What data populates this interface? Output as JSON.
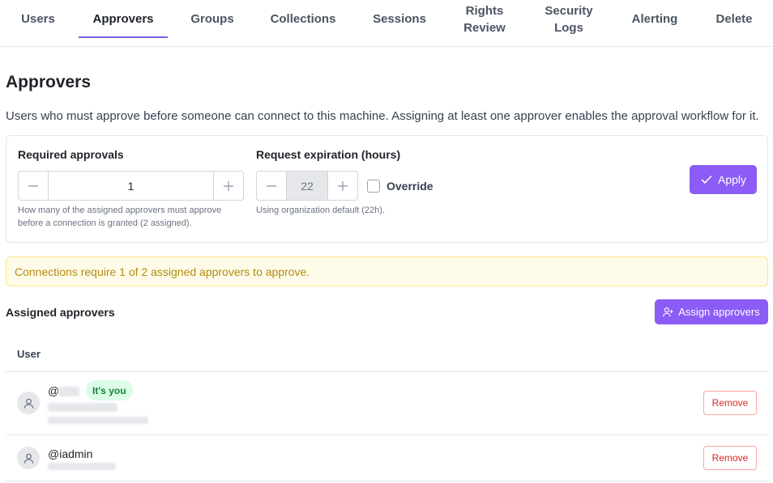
{
  "tabs": [
    {
      "label": "Users"
    },
    {
      "label": "Approvers",
      "active": true
    },
    {
      "label": "Groups"
    },
    {
      "label": "Collections"
    },
    {
      "label": "Sessions"
    },
    {
      "label": "Rights Review"
    },
    {
      "label": "Security Logs"
    },
    {
      "label": "Alerting"
    },
    {
      "label": "Delete"
    }
  ],
  "page": {
    "title": "Approvers",
    "description": "Users who must approve before someone can connect to this machine. Assigning at least one approver enables the approval workflow for it."
  },
  "settings": {
    "required_approvals": {
      "label": "Required approvals",
      "value": "1",
      "help_line1": "How many of the assigned approvers must approve",
      "help_line2": "before a connection is granted (2 assigned)."
    },
    "request_expiration": {
      "label": "Request expiration (hours)",
      "value": "22",
      "override_label": "Override",
      "override_checked": false,
      "help": "Using organization default (22h)."
    },
    "apply_label": "Apply"
  },
  "notice": "Connections require 1 of 2 assigned approvers to approve.",
  "assigned": {
    "title": "Assigned approvers",
    "assign_button": "Assign approvers",
    "column_user": "User",
    "rows": [
      {
        "username_prefix": "@",
        "badge": "It's you",
        "remove_label": "Remove"
      },
      {
        "username": "@iadmin",
        "remove_label": "Remove"
      }
    ]
  },
  "colors": {
    "accent": "#8b5cf6",
    "notice_text": "#b58a12",
    "badge_bg": "#dcfce7",
    "badge_text": "#15803d",
    "remove": "#dc2626"
  },
  "icons": {
    "minus": "minus-icon",
    "plus": "plus-icon",
    "check": "check-icon",
    "add_user": "user-plus-icon",
    "user": "user-icon"
  }
}
